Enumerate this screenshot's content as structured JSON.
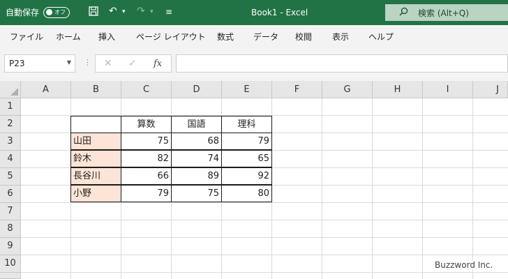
{
  "title_bar": {
    "autosave_label": "自動保存",
    "toggle_text": "オフ",
    "window_title": "Book1  -  Excel",
    "search_placeholder": "検索 (Alt+Q)"
  },
  "menu": [
    "ファイル",
    "ホーム",
    "挿入",
    "ページ レイアウト",
    "数式",
    "データ",
    "校閲",
    "表示",
    "ヘルプ"
  ],
  "formula_bar": {
    "name_box": "P23",
    "fx": "fx",
    "formula": ""
  },
  "columns": [
    "A",
    "B",
    "C",
    "D",
    "E",
    "F",
    "G",
    "H",
    "I",
    "J"
  ],
  "rows": [
    "1",
    "2",
    "3",
    "4",
    "5",
    "6",
    "7",
    "8",
    "9",
    "10"
  ],
  "table": {
    "headers": [
      "算数",
      "国語",
      "理科"
    ],
    "records": [
      {
        "name": "山田",
        "scores": [
          "75",
          "68",
          "79"
        ]
      },
      {
        "name": "鈴木",
        "scores": [
          "82",
          "74",
          "65"
        ]
      },
      {
        "name": "長谷川",
        "scores": [
          "66",
          "89",
          "92"
        ]
      },
      {
        "name": "小野",
        "scores": [
          "79",
          "75",
          "80"
        ]
      }
    ]
  },
  "watermark": "Buzzword Inc.",
  "colors": {
    "excel_green": "#217346",
    "name_cell_fill": "#fce4d6"
  }
}
